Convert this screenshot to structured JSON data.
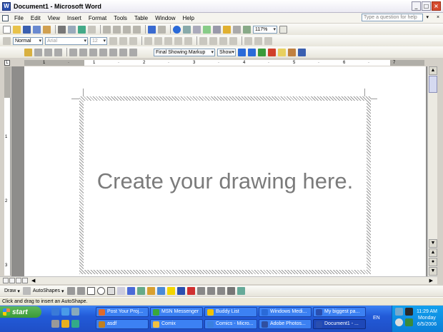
{
  "window": {
    "title": "Document1 - Microsoft Word",
    "app_icon_letter": "W"
  },
  "menu": {
    "items": [
      "File",
      "Edit",
      "View",
      "Insert",
      "Format",
      "Tools",
      "Table",
      "Window",
      "Help"
    ],
    "help_box_placeholder": "Type a question for help",
    "doc_close_glyph": "×"
  },
  "standard_toolbar": {
    "zoom": "117%"
  },
  "formatting_toolbar": {
    "style": "Normal",
    "font": "Arial",
    "size": "12"
  },
  "reviewing_toolbar": {
    "display_mode": "Final Showing Markup",
    "show_label": "Show"
  },
  "ruler": {
    "numbers": [
      "1",
      "·",
      "1",
      "·",
      "2",
      "·",
      "3",
      "·",
      "4",
      "·",
      "5",
      "·",
      "6",
      "·",
      "7"
    ],
    "vertical_numbers": [
      "1",
      "2",
      "3"
    ]
  },
  "canvas": {
    "placeholder": "Create your drawing here."
  },
  "drawing_toolbar": {
    "draw_label": "Draw",
    "autoshapes_label": "AutoShapes"
  },
  "status": {
    "message": "Click and drag to insert an AutoShape."
  },
  "taskbar": {
    "start_label": "start",
    "row1": [
      {
        "label": "Post Your Proj...",
        "color": "#e06a2a"
      },
      {
        "label": "MSN Messenger",
        "color": "#3aa83a"
      },
      {
        "label": "Buddy List",
        "color": "#f2c200"
      },
      {
        "label": "Windows Medi...",
        "color": "#2a6ad8"
      },
      {
        "label": "My biggest pa...",
        "color": "#2a4fb0"
      }
    ],
    "row2": [
      {
        "label": "asdf",
        "color": "#c08020"
      },
      {
        "label": "Comix",
        "color": "#f0c040"
      },
      {
        "label": "Comics - Micro...",
        "color": "#3a80e0"
      },
      {
        "label": "Adobe Photos...",
        "color": "#3050a0"
      },
      {
        "label": "Document1 - ...",
        "color": "#2a4fb0",
        "active": true
      }
    ],
    "language": "EN",
    "time": "11:29 AM",
    "day": "Monday",
    "date": "6/5/2006"
  }
}
